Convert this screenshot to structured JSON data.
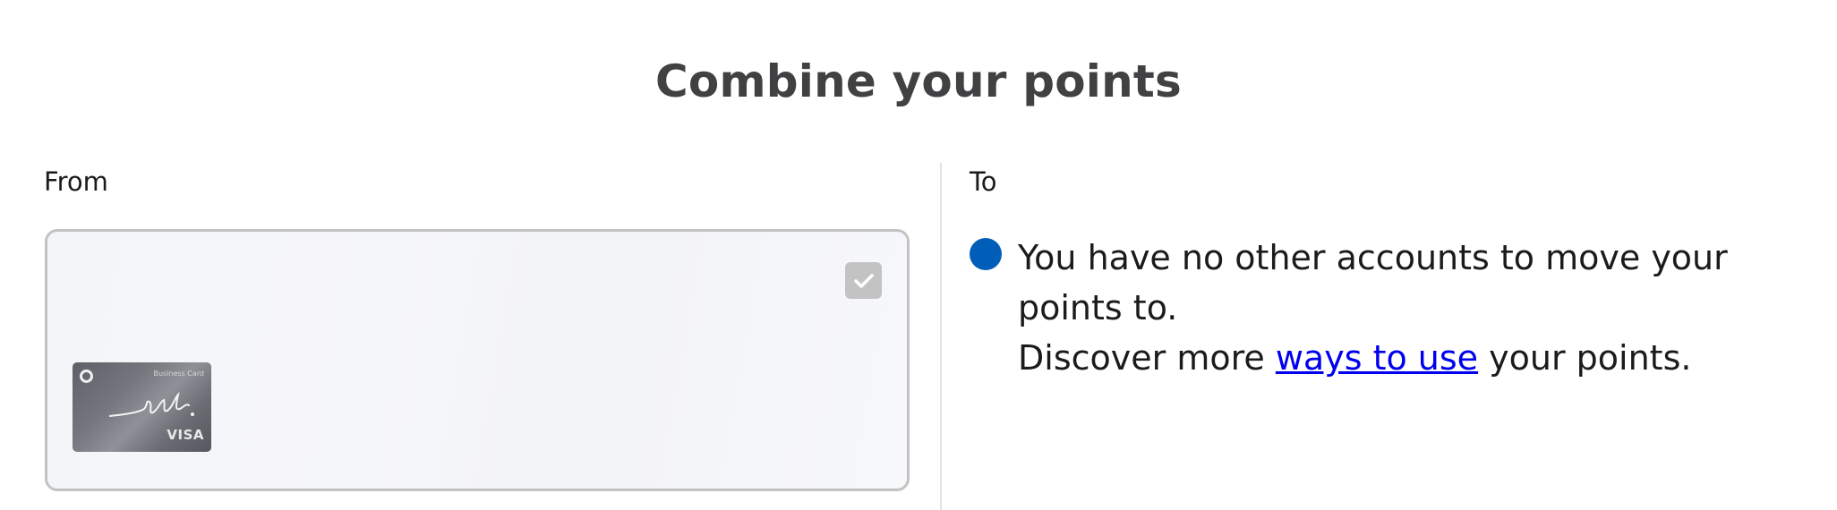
{
  "page": {
    "title": "Combine your points"
  },
  "from": {
    "label": "From",
    "account_card": {
      "selected": true,
      "card_image": {
        "brand_text": "Business Card",
        "network": "VISA",
        "signature": "ink."
      }
    }
  },
  "to": {
    "label": "To",
    "message": {
      "line_1": "You have no other accounts to move your points to.",
      "line_2_before": "Discover more ",
      "link_text": "ways to use",
      "line_2_after": " your points."
    }
  },
  "colors": {
    "title": "#414042",
    "info_icon": "#005eb8",
    "link": "#0000ee",
    "card_border": "#c3c3c3",
    "checkbox": "#c3c3c3"
  },
  "icons": {
    "checkbox": "checkmark-icon",
    "info": "info-dot-icon",
    "card_logo": "chase-logo-icon"
  }
}
